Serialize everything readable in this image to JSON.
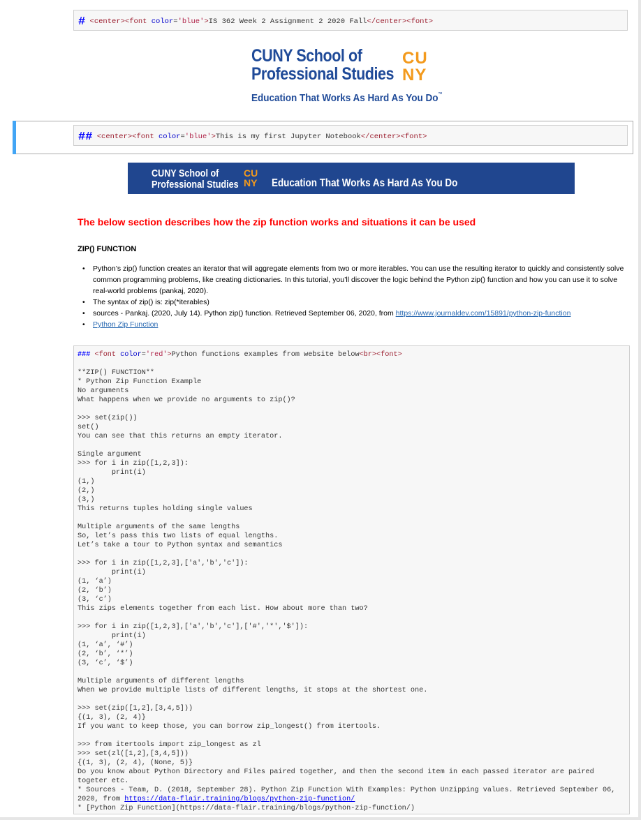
{
  "cell1": {
    "hash": "#",
    "open_center": "<center>",
    "open_font": "<font ",
    "attr": "color",
    "eq": "=",
    "value": "'blue'",
    "close_bracket": ">",
    "text": "IS 362 Week 2 Assignment 2 2020 Fall",
    "close_center": "</center>",
    "close_font": "<font>"
  },
  "logo_large": {
    "line1": "CUNY School of",
    "line2": "Professional Studies",
    "cu": "CU",
    "ny": "NY",
    "tagline": "Education That Works As Hard As You Do",
    "tm": "™"
  },
  "cell2": {
    "hash": "##",
    "open_center": "<center>",
    "open_font": "<font ",
    "attr": "color",
    "eq": "=",
    "value": "'blue'",
    "close_bracket": ">",
    "text": "This is my first Jupyter Notebook",
    "close_center": "</center>",
    "close_font": "<font>"
  },
  "banner": {
    "line1": "CUNY School of",
    "line2": "Professional Studies",
    "cu": "CU",
    "ny": "NY",
    "tagline": "Education That Works As Hard As You Do"
  },
  "section_heading": "The below section describes how the zip function works and situations it can be used",
  "zip_heading": "ZIP() FUNCTION",
  "bullets": {
    "b1": "Python’s zip() function creates an iterator that will aggregate elements from two or more iterables. You can use the resulting iterator to quickly and consistently solve common programming problems, like creating dictionaries. In this tutorial, you’ll discover the logic behind the Python zip() function and how you can use it to solve real-world problems (pankaj, 2020).",
    "b2": "The syntax of zip() is: zip(*iterables)",
    "b3_text": "sources - Pankaj. (2020, July 14). Python zip() function. Retrieved September 06, 2020, from ",
    "b3_link": "https://www.journaldev.com/15891/python-zip-function",
    "b4_link": "Python Zip Function"
  },
  "code": {
    "h3": "###",
    "font_open": "<font ",
    "attr": "color",
    "eq": "=",
    "value": "'red'",
    "gt": ">",
    "header_text": "Python functions examples from website below",
    "br": "<br>",
    "font_close": "<font>",
    "body": "\n**ZIP() FUNCTION**\n* Python Zip Function Example\nNo arguments\nWhat happens when we provide no arguments to zip()?\n\n>>> set(zip())\nset()\nYou can see that this returns an empty iterator.\n\nSingle argument\n>>> for i in zip([1,2,3]):\n        print(i)\n(1,)\n(2,)\n(3,)\nThis returns tuples holding single values\n\nMultiple arguments of the same lengths\nSo, let’s pass this two lists of equal lengths.\nLet’s take a tour to Python syntax and semantics\n\n>>> for i in zip([1,2,3],['a','b','c']):\n        print(i)\n(1, ‘a’)\n(2, ‘b’)\n(3, ‘c’)\nThis zips elements together from each list. How about more than two?\n\n>>> for i in zip([1,2,3],['a','b','c'],['#','*','$']):\n        print(i)\n(1, ‘a’, ‘#’)\n(2, ‘b’, ‘*’)\n(3, ‘c’, ‘$’)\n\nMultiple arguments of different lengths\nWhen we provide multiple lists of different lengths, it stops at the shortest one.\n\n>>> set(zip([1,2],[3,4,5]))\n{(1, 3), (2, 4)}\nIf you want to keep those, you can borrow zip_longest() from itertools.\n\n>>> from itertools import zip_longest as zl\n>>> set(zl([1,2],[3,4,5]))\n{(1, 3), (2, 4), (None, 5)}\nDo you know about Python Directory and Files paired together, and then the second item in each passed iterator are paired\ntogeter etc.\n* Sources - Team, D. (2018, September 28). Python Zip Function With Examples: Python Unzipping values. Retrieved September 06,\n2020, from ",
    "url": "https://data-flair.training/blogs/python-zip-function/",
    "last_line": "\n* [Python Zip Function](https://data-flair.training/blogs/python-zip-function/)"
  }
}
